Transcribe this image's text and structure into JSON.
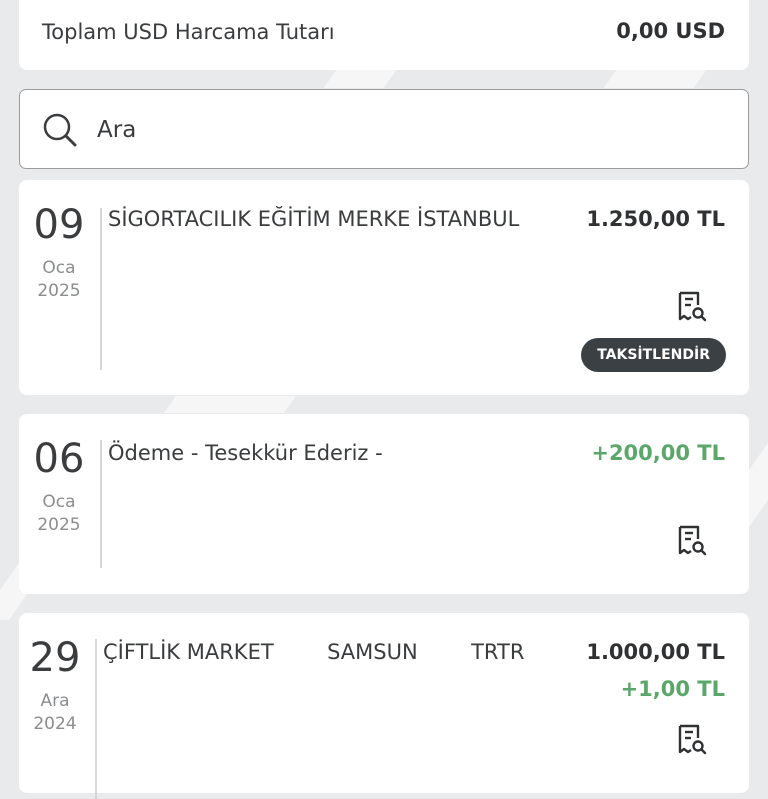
{
  "summary": {
    "label": "Toplam USD Harcama Tutarı",
    "value": "0,00 USD"
  },
  "search": {
    "placeholder": "Ara"
  },
  "transactions": [
    {
      "day": "09",
      "month": "Oca",
      "year": "2025",
      "description": "SİGORTACILIK EĞİTİM MERKE İSTANBUL",
      "amount": "1.250,00 TL",
      "action": "TAKSİTLENDİR"
    },
    {
      "day": "06",
      "month": "Oca",
      "year": "2025",
      "description": "Ödeme - Tesekkür Ederiz -",
      "amount": "+200,00 TL"
    },
    {
      "day": "29",
      "month": "Ara",
      "year": "2024",
      "description": "ÇİFTLİK MARKET        SAMSUN        TRTR",
      "amount": "1.000,00 TL",
      "sub_amount": "+1,00 TL"
    }
  ],
  "icons": {
    "search": "search-icon",
    "receipt": "receipt-search-icon"
  },
  "colors": {
    "positive": "#5aa769",
    "pill": "#3b4044"
  }
}
